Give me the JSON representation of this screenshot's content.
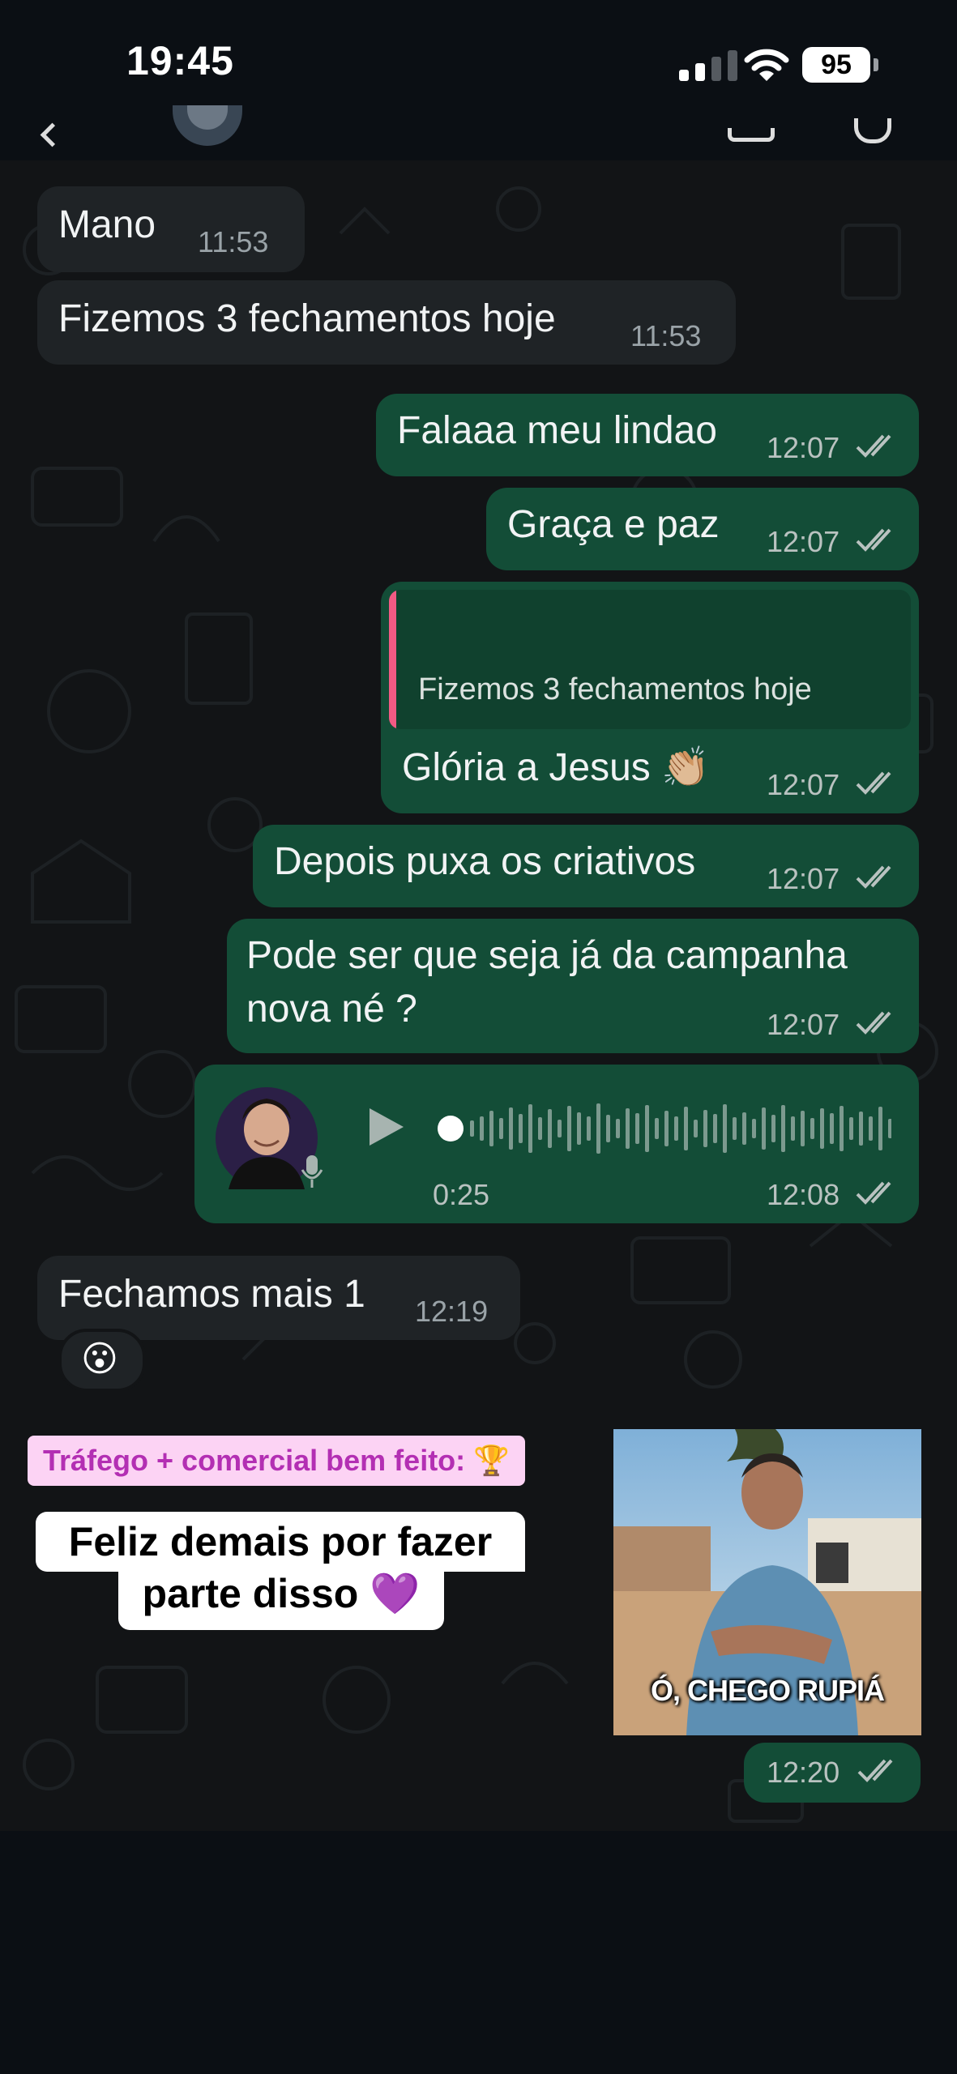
{
  "status_bar": {
    "time": "19:45",
    "battery": "95"
  },
  "messages": [
    {
      "dir": "in",
      "text": "Mano",
      "time": "11:53"
    },
    {
      "dir": "in",
      "text": "Fizemos 3 fechamentos hoje",
      "time": "11:53"
    },
    {
      "dir": "out",
      "text": "Falaaa meu lindao",
      "time": "12:07"
    },
    {
      "dir": "out",
      "text": "Graça e paz",
      "time": "12:07"
    },
    {
      "dir": "out",
      "quote": "Fizemos 3 fechamentos hoje",
      "text": "Glória a Jesus 👏🏼",
      "time": "12:07"
    },
    {
      "dir": "out",
      "text": "Depois puxa os criativos",
      "time": "12:07"
    },
    {
      "dir": "out",
      "text_line1": "Pode ser que seja já da campanha",
      "text_line2": "nova né ?",
      "time": "12:07"
    },
    {
      "dir": "out",
      "type": "voice",
      "duration": "0:25",
      "time": "12:08"
    },
    {
      "dir": "in",
      "text": "Fechamos mais 1",
      "time": "12:19",
      "reaction": "😮"
    },
    {
      "dir": "out",
      "type": "image",
      "caption_in_image": "Ó, CHEGO RUPIÁ",
      "time": "12:20"
    }
  ],
  "overlay": {
    "pill": "Tráfego + comercial bem feito: 🏆",
    "caption_line1": "Feliz demais por fazer",
    "caption_line2": "parte disso 💜"
  },
  "colors": {
    "incoming": "#1f2326",
    "outgoing": "#134d37",
    "quote_bar": "#f25a84",
    "pill_bg": "#fcd3f4",
    "pill_text": "#b32fb3",
    "read_ticks": "#b9c2c0"
  },
  "icons": [
    "back-icon",
    "video-call-icon",
    "voice-call-icon",
    "play-icon",
    "microphone-icon",
    "double-check-icon"
  ]
}
